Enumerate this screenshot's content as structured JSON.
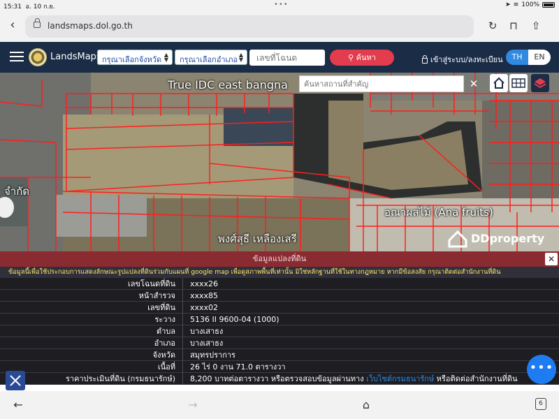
{
  "status": {
    "time": "15:31",
    "date": "อ. 10 ก.ย.",
    "battery": "100%"
  },
  "browser": {
    "url": "landsmaps.dol.go.th"
  },
  "nav": {
    "brand": "LandsMaps",
    "province_select": "กรุณาเลือกจังหวัด",
    "district_select": "กรุณาเลือกอำเภอ",
    "deed_placeholder": "เลขที่โฉนด",
    "search_label": "ค้นหา",
    "login_label": "เข้าสู่ระบบ/ลงทะเบียน",
    "lang_th": "TH",
    "lang_en": "EN"
  },
  "map": {
    "place_search_placeholder": "ค้นหาสถานที่สำคัญ",
    "labels": {
      "true_idc": "True IDC east bangna",
      "owner": "พงศ์สุธี เหลืองเสรี",
      "fruits": "อณาผลไม้ (Ana fruits)",
      "company_fragment": "จำกัด",
      "ddproperty": "DDproperty"
    }
  },
  "panel": {
    "title": "ข้อมูลแปลงที่ดิน",
    "notice": "ข้อมูลนี้เพื่อใช้ประกอบการแสดงลักษณะรูปแปลงที่ดินร่วมกับแผนที่ google map เพื่อดูสภาพพื้นที่เท่านั้น มิใช่หลักฐานที่ใช้ในทางกฎหมาย หากมีข้อสงสัย กรุณาติดต่อสำนักงานที่ดิน",
    "rows": [
      {
        "key": "เลขโฉนดที่ดิน",
        "value": "xxxx26"
      },
      {
        "key": "หน้าสำรวจ",
        "value": "xxxx85"
      },
      {
        "key": "เลขที่ดิน",
        "value": "xxxx02"
      },
      {
        "key": "ระวาง",
        "value": "5136 II 9600-04 (1000)"
      },
      {
        "key": "ตำบล",
        "value": "บางเสาธง"
      },
      {
        "key": "อำเภอ",
        "value": "บางเสาธง"
      },
      {
        "key": "จังหวัด",
        "value": "สมุทรปราการ"
      },
      {
        "key": "เนื้อที่",
        "value": "26 ไร่ 0 งาน 71.0 ตารางวา"
      }
    ],
    "price_row": {
      "key": "ราคาประเมินที่ดิน (กรมธนารักษ์)",
      "value_before": "8,200 บาทต่อตารางวา หรือตรวจสอบข้อมูลผ่านทาง ",
      "link": "เว็บไซต์กรมธนารักษ์",
      "value_after": " หรือติดต่อสำนักงานที่ดิน"
    },
    "fab_label": "•••"
  },
  "bottom": {
    "tabs_count": "6"
  },
  "colors": {
    "nav": "#1a2c46",
    "accent_red": "#e23c4e",
    "lang_active": "#2f8ae0",
    "panel_title": "#8a2a31",
    "notice_text": "#ffe46b",
    "fab": "#1e7cf2"
  }
}
